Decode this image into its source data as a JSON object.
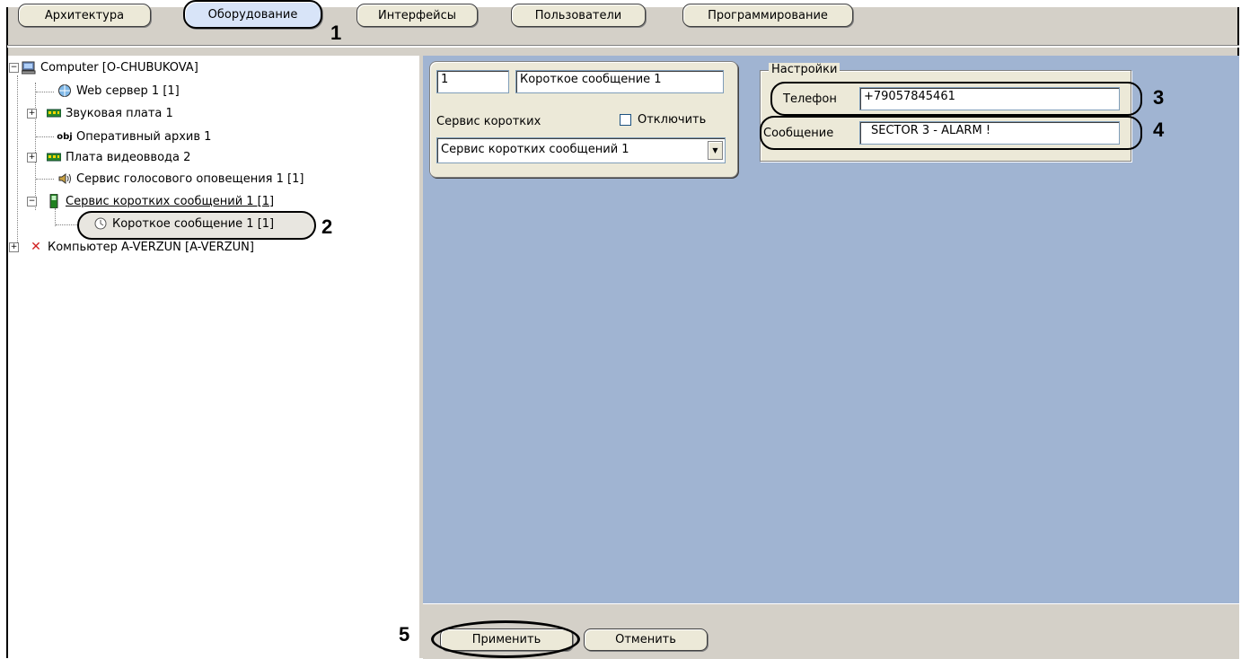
{
  "tabs": [
    {
      "label": "Архитектура"
    },
    {
      "label": "Оборудование"
    },
    {
      "label": "Интерфейсы"
    },
    {
      "label": "Пользователи"
    },
    {
      "label": "Программирование"
    }
  ],
  "markers": {
    "m1": "1",
    "m2": "2",
    "m3": "3",
    "m4": "4",
    "m5": "5"
  },
  "tree": {
    "items": [
      {
        "label": "Computer [O-CHUBUKOVA]",
        "icon": "computer-icon"
      },
      {
        "label": "Web сервер 1 [1]",
        "icon": "web-server-icon"
      },
      {
        "label": "Звуковая плата 1",
        "icon": "board-icon"
      },
      {
        "label": "Оперативный архив 1",
        "icon": "obj-icon",
        "icon_text": "obj"
      },
      {
        "label": "Плата видеоввода 2",
        "icon": "board-icon"
      },
      {
        "label": "Сервис голосового оповещения 1 [1]",
        "icon": "speaker-icon"
      },
      {
        "label": "Сервис коротких сообщений 1 [1]",
        "icon": "phone-icon"
      },
      {
        "label": "Короткое сообщение 1 [1]",
        "icon": "message-icon"
      },
      {
        "label": "Компьютер A-VERZUN [A-VERZUN]",
        "icon": "cross-icon"
      }
    ]
  },
  "settings": {
    "id_value": "1",
    "name_value": "Короткое сообщение 1",
    "service_label": "Сервис коротких",
    "disable_label": "Отключить",
    "service_select": "Сервис коротких сообщений 1",
    "group_title": "Настройки",
    "phone_label": "Телефон",
    "phone_value": "+79057845461",
    "message_label": "Сообщение",
    "message_value": "SECTOR 3 - ALARM !"
  },
  "buttons": {
    "apply": "Применить",
    "cancel": "Отменить"
  }
}
